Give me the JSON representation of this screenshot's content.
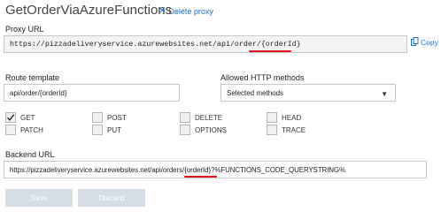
{
  "header": {
    "title": "GetOrderViaAzureFunctions",
    "delete_label": "Delete proxy"
  },
  "proxy_url": {
    "label": "Proxy URL",
    "prefix": "https://pizzadeliveryservice.azurewebsites.net/api/order/",
    "param": "{orderId}",
    "copy_label": "Copy"
  },
  "route_template": {
    "label": "Route template",
    "value": "api/order/{orderId}"
  },
  "allowed_methods": {
    "label": "Allowed HTTP methods",
    "selected": "Selected methods",
    "methods": [
      {
        "name": "GET",
        "checked": true
      },
      {
        "name": "POST",
        "checked": false
      },
      {
        "name": "DELETE",
        "checked": false
      },
      {
        "name": "HEAD",
        "checked": false
      },
      {
        "name": "PATCH",
        "checked": false
      },
      {
        "name": "PUT",
        "checked": false
      },
      {
        "name": "OPTIONS",
        "checked": false
      },
      {
        "name": "TRACE",
        "checked": false
      }
    ]
  },
  "backend_url": {
    "label": "Backend URL",
    "prefix": "https://pizzadeliveryservice.azurewebsites.net/api/orders/",
    "param": "{orderId}",
    "suffix": "?%FUNCTIONS_CODE_QUERYSTRING%"
  },
  "buttons": {
    "save": "Save",
    "discard": "Discard"
  },
  "colors": {
    "accent": "#1e73c8",
    "highlight": "#d9141b",
    "disabled_button": "#d5dde6"
  }
}
